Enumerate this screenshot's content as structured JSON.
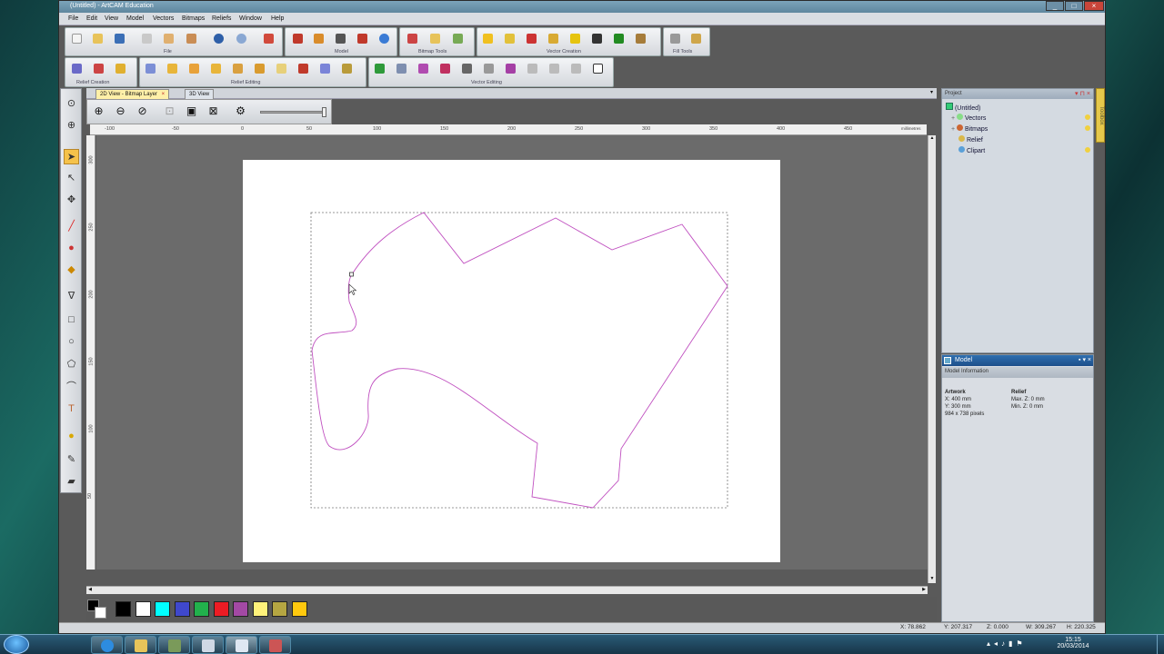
{
  "window": {
    "title": "(Untitled) - ArtCAM Education"
  },
  "menu": [
    "File",
    "Edit",
    "View",
    "Model",
    "Vectors",
    "Bitmaps",
    "Reliefs",
    "Window",
    "Help"
  ],
  "toolbar_groups": {
    "file": "File",
    "model": "Model",
    "bitmap_tools": "Bitmap Tools",
    "vector_creation": "Vector Creation",
    "fill_tools": "Fill Tools",
    "relief_creation": "Relief Creation",
    "relief_editing": "Relief Editing",
    "vector_editing": "Vector Editing"
  },
  "tabs": {
    "view2d": "2D View - Bitmap Layer",
    "view3d": "3D View",
    "close": "×"
  },
  "ruler": {
    "h_ticks": [
      "-100",
      "-50",
      "0",
      "50",
      "100",
      "150",
      "200",
      "250",
      "300",
      "350",
      "400",
      "450"
    ],
    "v_ticks": [
      "300",
      "250",
      "200",
      "150",
      "100",
      "50"
    ],
    "units": "millimetres"
  },
  "project": {
    "header": "Project",
    "root": "(Untitled)",
    "items": [
      "Vectors",
      "Bitmaps",
      "Relief",
      "Clipart"
    ]
  },
  "model_panel": {
    "header": "Model",
    "info_header": "Model Information",
    "artwork_title": "Artwork",
    "relief_title": "Relief",
    "x": "X: 400 mm",
    "y": "Y: 300 mm",
    "pixels": "984 x 738 pixels",
    "max_z": "Max. Z: 0 mm",
    "min_z": "Min. Z: 0 mm"
  },
  "toolbox_label": "Toolbox",
  "status": {
    "x": "X: 78.862",
    "y": "Y: 207.317",
    "z": "Z: 0.000",
    "w": "W: 309.267",
    "h": "H: 220.325"
  },
  "clock": {
    "time": "15:15",
    "date": "20/03/2014"
  },
  "palette_colors": [
    "#000000",
    "#ffffff",
    "#00ffff",
    "#3f48cc",
    "#22b14c",
    "#ed1c24",
    "#a349a4",
    "#fff27a",
    "#b5a642",
    "#ffc90e"
  ],
  "vector_color": "#c050c0"
}
